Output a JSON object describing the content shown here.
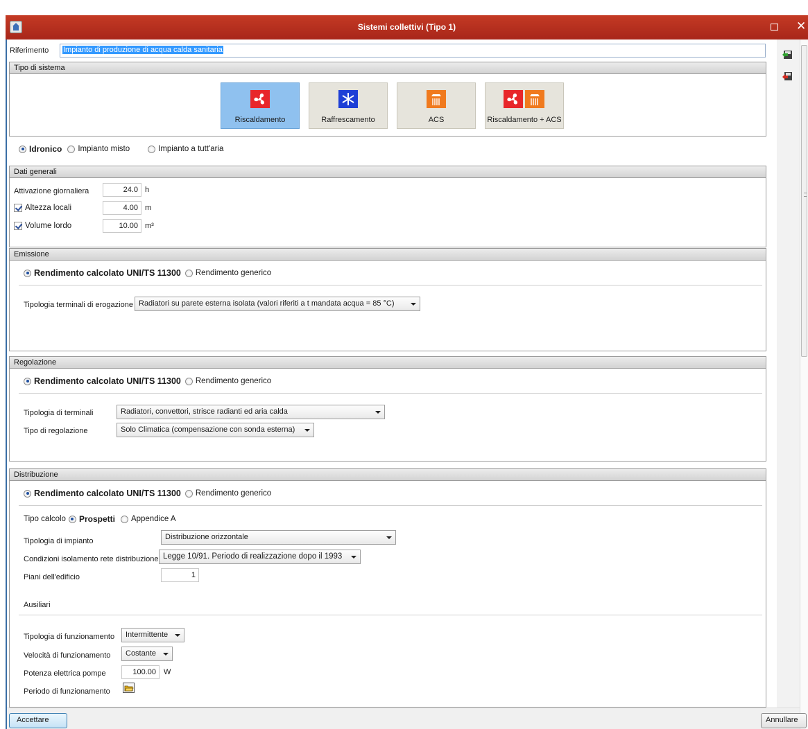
{
  "window": {
    "title": "Sistemi collettivi (Tipo 1)"
  },
  "reference": {
    "label": "Riferimento",
    "value": "Impianto di produzione di acqua calda sanitaria"
  },
  "system_type": {
    "header": "Tipo di sistema",
    "tiles": [
      {
        "label": "Riscaldamento",
        "icon": "fan-heating-icon",
        "active": true
      },
      {
        "label": "Raffrescamento",
        "icon": "snowflake-cooling-icon",
        "active": false
      },
      {
        "label": "ACS",
        "icon": "shower-hot-water-icon",
        "active": false
      },
      {
        "label": "Riscaldamento + ACS",
        "icon": "fan-and-shower-icon",
        "active": false
      }
    ],
    "plant_options": [
      {
        "label": "Idronico",
        "selected": true
      },
      {
        "label": "Impianto misto",
        "selected": false
      },
      {
        "label": "Impianto a tutt'aria",
        "selected": false
      }
    ]
  },
  "general": {
    "header": "Dati generali",
    "daily_activation": {
      "label": "Attivazione giornaliera",
      "value": "24.0",
      "unit": "h"
    },
    "room_height": {
      "label": "Altezza locali",
      "value": "4.00",
      "unit": "m",
      "checked": true
    },
    "gross_volume": {
      "label": "Volume lordo",
      "value": "10.00",
      "unit": "m³",
      "checked": true
    }
  },
  "emission": {
    "header": "Emissione",
    "calc_label": "Rendimento calcolato UNI/TS 11300",
    "generic_label": "Rendimento generico",
    "terminal_label": "Tipologia terminali di erogazione",
    "terminal_value": "Radiatori su parete esterna isolata (valori riferiti a t mandata acqua = 85 °C)"
  },
  "regulation": {
    "header": "Regolazione",
    "calc_label": "Rendimento calcolato UNI/TS 11300",
    "generic_label": "Rendimento generico",
    "terminals_label": "Tipologia di terminali",
    "terminals_value": "Radiatori, convettori, strisce radianti ed aria calda",
    "regulation_type_label": "Tipo di regolazione",
    "regulation_type_value": "Solo Climatica (compensazione con sonda esterna)"
  },
  "distribution": {
    "header": "Distribuzione",
    "calc_label": "Rendimento calcolato UNI/TS 11300",
    "generic_label": "Rendimento generico",
    "calc_type_label": "Tipo calcolo",
    "calc_type_prospetti": "Prospetti",
    "calc_type_appendix": "Appendice A",
    "plant_type_label": "Tipologia di impianto",
    "plant_type_value": "Distribuzione orizzontale",
    "insulation_label": "Condizioni isolamento rete distribuzione",
    "insulation_value": "Legge 10/91. Periodo di realizzazione dopo il 1993",
    "floors_label": "Piani dell'edificio",
    "floors_value": "1",
    "aux_header": "Ausiliari",
    "operation_type_label": "Tipologia di funzionamento",
    "operation_type_value": "Intermittente",
    "speed_label": "Velocità di funzionamento",
    "speed_value": "Costante",
    "pump_power_label": "Potenza elettrica pompe",
    "pump_power_value": "100.00",
    "pump_power_unit": "W",
    "period_label": "Periodo di funzionamento"
  },
  "footer": {
    "accept": "Accettare",
    "cancel": "Annullare"
  },
  "colors": {
    "titlebar": "#b02c1d",
    "active_tile": "#8fc1ef",
    "selection": "#3399ff"
  }
}
